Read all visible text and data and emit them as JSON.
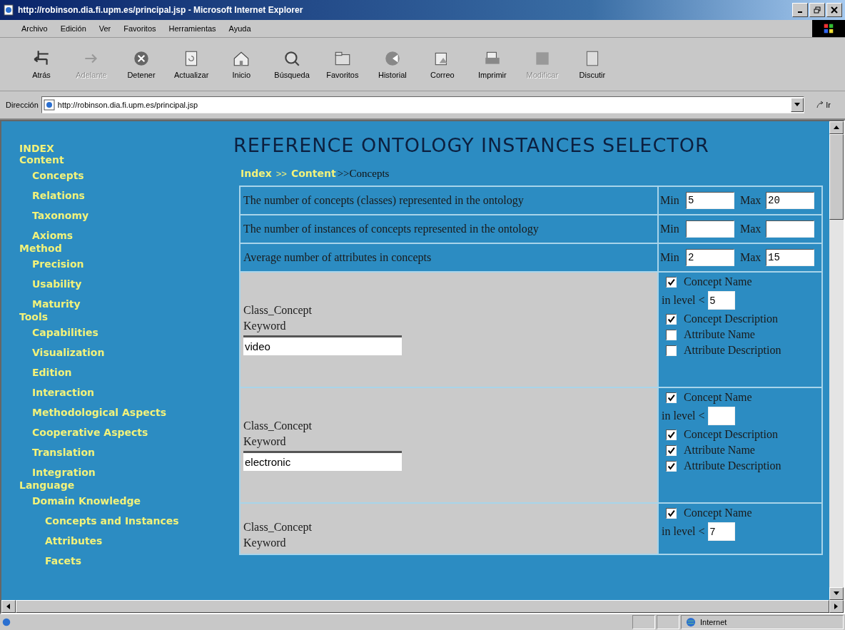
{
  "window": {
    "title": "http://robinson.dia.fi.upm.es/principal.jsp - Microsoft Internet Explorer"
  },
  "menu": [
    "Archivo",
    "Edición",
    "Ver",
    "Favoritos",
    "Herramientas",
    "Ayuda"
  ],
  "toolbar": [
    {
      "kind": "back",
      "label": "Atrás",
      "disabled": false
    },
    {
      "kind": "forward",
      "label": "Adelante",
      "disabled": true
    },
    {
      "kind": "stop",
      "label": "Detener",
      "disabled": false
    },
    {
      "kind": "refresh",
      "label": "Actualizar",
      "disabled": false
    },
    {
      "kind": "home",
      "label": "Inicio",
      "disabled": false
    },
    {
      "kind": "search",
      "label": "Búsqueda",
      "disabled": false
    },
    {
      "kind": "favorites",
      "label": "Favoritos",
      "disabled": false
    },
    {
      "kind": "history",
      "label": "Historial",
      "disabled": false
    },
    {
      "kind": "mail",
      "label": "Correo",
      "disabled": false
    },
    {
      "kind": "print",
      "label": "Imprimir",
      "disabled": false
    },
    {
      "kind": "edit",
      "label": "Modificar",
      "disabled": true
    },
    {
      "kind": "discuss",
      "label": "Discutir",
      "disabled": false
    }
  ],
  "address": {
    "label": "Dirección",
    "value": "http://robinson.dia.fi.upm.es/principal.jsp",
    "go": "Ir"
  },
  "sidebar": {
    "items": [
      {
        "label": "INDEX"
      },
      {
        "label": "Content",
        "children": [
          {
            "label": "Concepts"
          },
          {
            "label": "Relations"
          },
          {
            "label": "Taxonomy"
          },
          {
            "label": "Axioms"
          }
        ]
      },
      {
        "label": "Method",
        "children": [
          {
            "label": "Precision"
          },
          {
            "label": "Usability"
          },
          {
            "label": "Maturity"
          }
        ]
      },
      {
        "label": "Tools",
        "children": [
          {
            "label": "Capabilities"
          },
          {
            "label": "Visualization"
          },
          {
            "label": "Edition"
          },
          {
            "label": "Interaction"
          },
          {
            "label": "Methodological Aspects"
          },
          {
            "label": "Cooperative Aspects"
          },
          {
            "label": "Translation"
          },
          {
            "label": "Integration"
          }
        ]
      },
      {
        "label": "Language",
        "children": [
          {
            "label": "Domain Knowledge",
            "children": [
              {
                "label": "Concepts and Instances"
              },
              {
                "label": "Attributes"
              },
              {
                "label": "Facets"
              }
            ]
          }
        ]
      }
    ]
  },
  "heading": "REFERENCE ONTOLOGY INSTANCES SELECTOR",
  "breadcrumb": {
    "links": [
      "Index",
      "Content"
    ],
    "separator": ">>",
    "current": ">>Concepts"
  },
  "ranges": [
    {
      "label": "The number of concepts (classes) represented in the ontology",
      "min_label": "Min",
      "min": "5",
      "max_label": "Max",
      "max": "20"
    },
    {
      "label": "The number of instances of concepts represented in the ontology",
      "min_label": "Min",
      "max_label": "Max"
    },
    {
      "label": "Average number of attributes in concepts",
      "min_label": "Min",
      "min": "2",
      "max_label": "Max",
      "max": "15"
    }
  ],
  "keywords": [
    {
      "class_label": "Class_Concept",
      "keyword_label": "Keyword",
      "value": "video",
      "options": [
        {
          "kind": "check",
          "label": "Concept Name",
          "checked": true
        },
        {
          "kind": "level",
          "label": "in level <",
          "value": "5"
        },
        {
          "kind": "check",
          "label": "Concept Description",
          "checked": true
        },
        {
          "kind": "check",
          "label": "Attribute Name",
          "checked": false
        },
        {
          "kind": "check",
          "label": "Attribute Description",
          "checked": false
        }
      ]
    },
    {
      "class_label": "Class_Concept",
      "keyword_label": "Keyword",
      "value": "electronic",
      "options": [
        {
          "kind": "check",
          "label": "Concept Name",
          "checked": true
        },
        {
          "kind": "level",
          "label": "in level <"
        },
        {
          "kind": "check",
          "label": "Concept Description",
          "checked": true
        },
        {
          "kind": "check",
          "label": "Attribute Name",
          "checked": true
        },
        {
          "kind": "check",
          "label": "Attribute Description",
          "checked": true
        }
      ]
    },
    {
      "class_label": "Class_Concept",
      "keyword_label": "Keyword",
      "options": [
        {
          "kind": "check",
          "label": "Concept Name",
          "checked": true
        },
        {
          "kind": "level",
          "label": "in level <",
          "value": "7"
        }
      ]
    }
  ],
  "status_bar": {
    "zone": "Internet"
  }
}
